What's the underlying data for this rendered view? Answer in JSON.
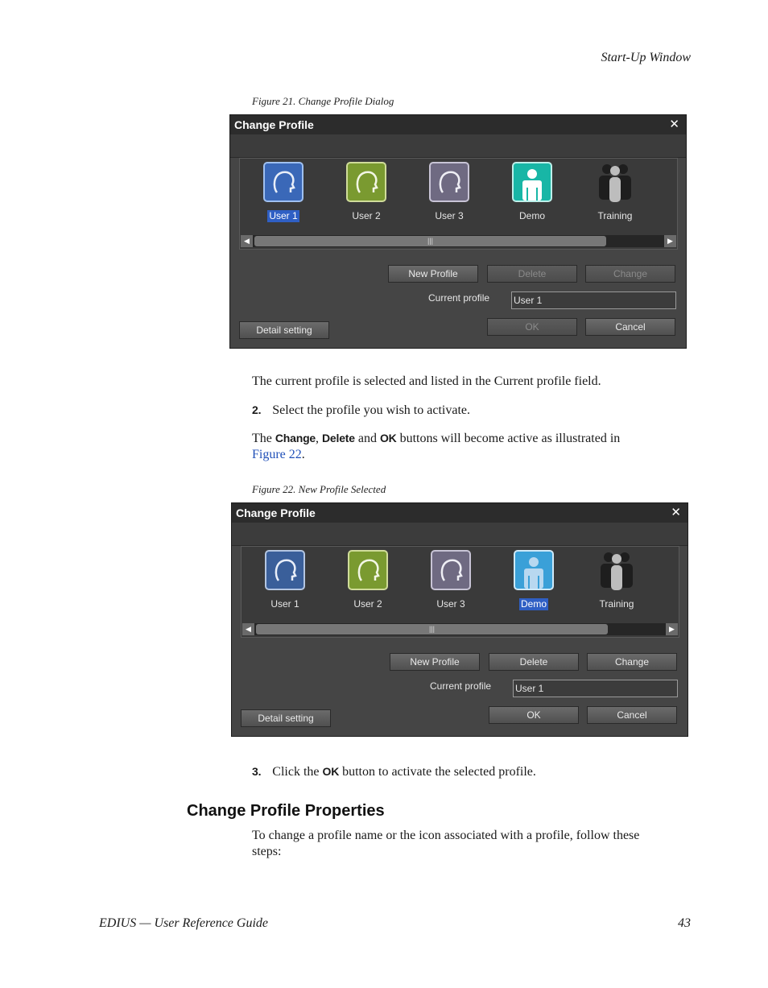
{
  "page": {
    "header": "Start-Up Window",
    "fig21_caption": "Figure 21.  Change Profile Dialog",
    "para1": "The current profile is selected and listed in the Current profile field.",
    "step2_num": "2.",
    "step2_text": "Select the profile you wish to activate.",
    "para2_pre": "The ",
    "para2_change": "Change",
    "para2_sep": ", ",
    "para2_delete": "Delete",
    "para2_and": " and ",
    "para2_ok": "OK",
    "para2_post": " buttons will become active as illustrated in",
    "para2_link": "Figure 22",
    "para2_end": ".",
    "fig22_caption": "Figure 22.  New Profile Selected",
    "step3_num": "3.",
    "step3_pre": "Click the ",
    "step3_ok": "OK",
    "step3_post": " button to activate the selected profile.",
    "section_title": "Change Profile Properties",
    "para3_line1": "To change a profile name or the icon associated with a profile, follow these",
    "para3_line2": "steps:",
    "footer_left": "EDIUS  —  User Reference Guide",
    "footer_right": "43"
  },
  "dialog1": {
    "title": "Change Profile",
    "close": "✕",
    "profiles": [
      {
        "label": "User 1",
        "icon": "head-icon",
        "color": "#3a68b8",
        "selected": true
      },
      {
        "label": "User 2",
        "icon": "head-icon",
        "color": "#7a9a30",
        "selected": false
      },
      {
        "label": "User 3",
        "icon": "head-icon",
        "color": "#6f6a82",
        "selected": false
      },
      {
        "label": "Demo",
        "icon": "person-icon",
        "color": "#18b6a6",
        "selected": false
      },
      {
        "label": "Training",
        "icon": "group-icon",
        "color": "#404040",
        "selected": false
      }
    ],
    "scroll_thumb": "|||",
    "new_profile": "New Profile",
    "delete": "Delete",
    "change": "Change",
    "current_profile_label": "Current profile",
    "current_profile_value": "User 1",
    "detail_setting": "Detail setting",
    "ok": "OK",
    "cancel": "Cancel"
  },
  "dialog2": {
    "title": "Change Profile",
    "close": "✕",
    "profiles": [
      {
        "label": "User 1",
        "icon": "head-icon",
        "color": "#3a5f9a",
        "selected": false
      },
      {
        "label": "User 2",
        "icon": "head-icon",
        "color": "#7a9a30",
        "selected": false
      },
      {
        "label": "User 3",
        "icon": "head-icon",
        "color": "#6f6a82",
        "selected": false
      },
      {
        "label": "Demo",
        "icon": "person-icon",
        "color": "#3aa0d8",
        "selected": true
      },
      {
        "label": "Training",
        "icon": "group-icon",
        "color": "#404040",
        "selected": false
      }
    ],
    "scroll_thumb": "|||",
    "new_profile": "New Profile",
    "delete": "Delete",
    "change": "Change",
    "current_profile_label": "Current profile",
    "current_profile_value": "User 1",
    "detail_setting": "Detail setting",
    "ok": "OK",
    "cancel": "Cancel"
  }
}
